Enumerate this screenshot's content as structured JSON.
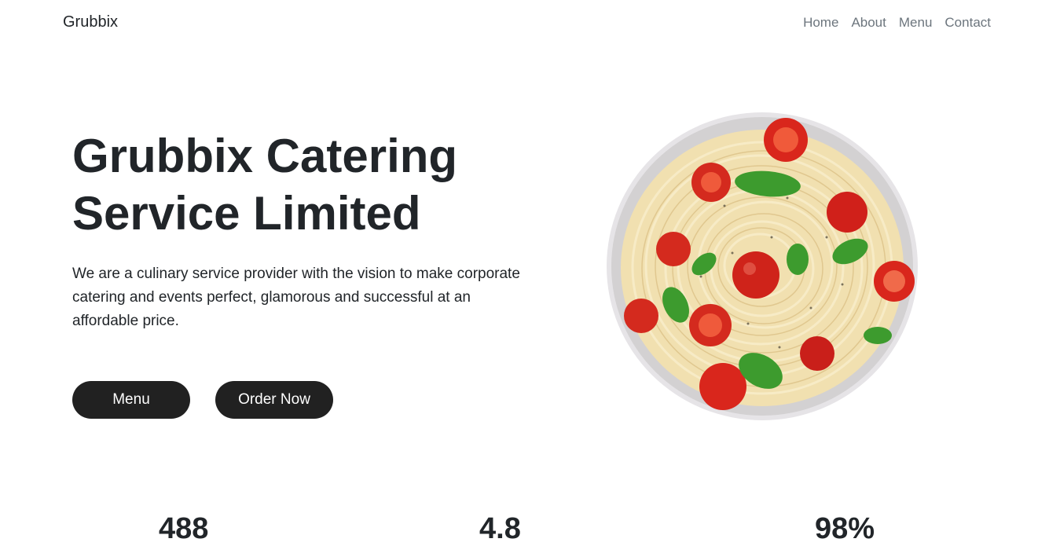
{
  "nav": {
    "brand": "Grubbix",
    "links": [
      "Home",
      "About",
      "Menu",
      "Contact"
    ]
  },
  "hero": {
    "title_line1": "Grubbix Catering",
    "title_line2": "Service Limited",
    "description": "We are a culinary service provider with the vision to make corporate catering and events perfect, glamorous and successful at an affordable price.",
    "buttons": {
      "menu": "Menu",
      "order": "Order Now"
    },
    "image": "spaghetti-tomato-basil-bowl"
  },
  "stats": [
    "488",
    "4.8",
    "98%"
  ],
  "colors": {
    "text": "#212529",
    "nav_link": "#6c757d",
    "button_bg": "#212121",
    "button_text": "#ffffff",
    "background": "#ffffff"
  }
}
